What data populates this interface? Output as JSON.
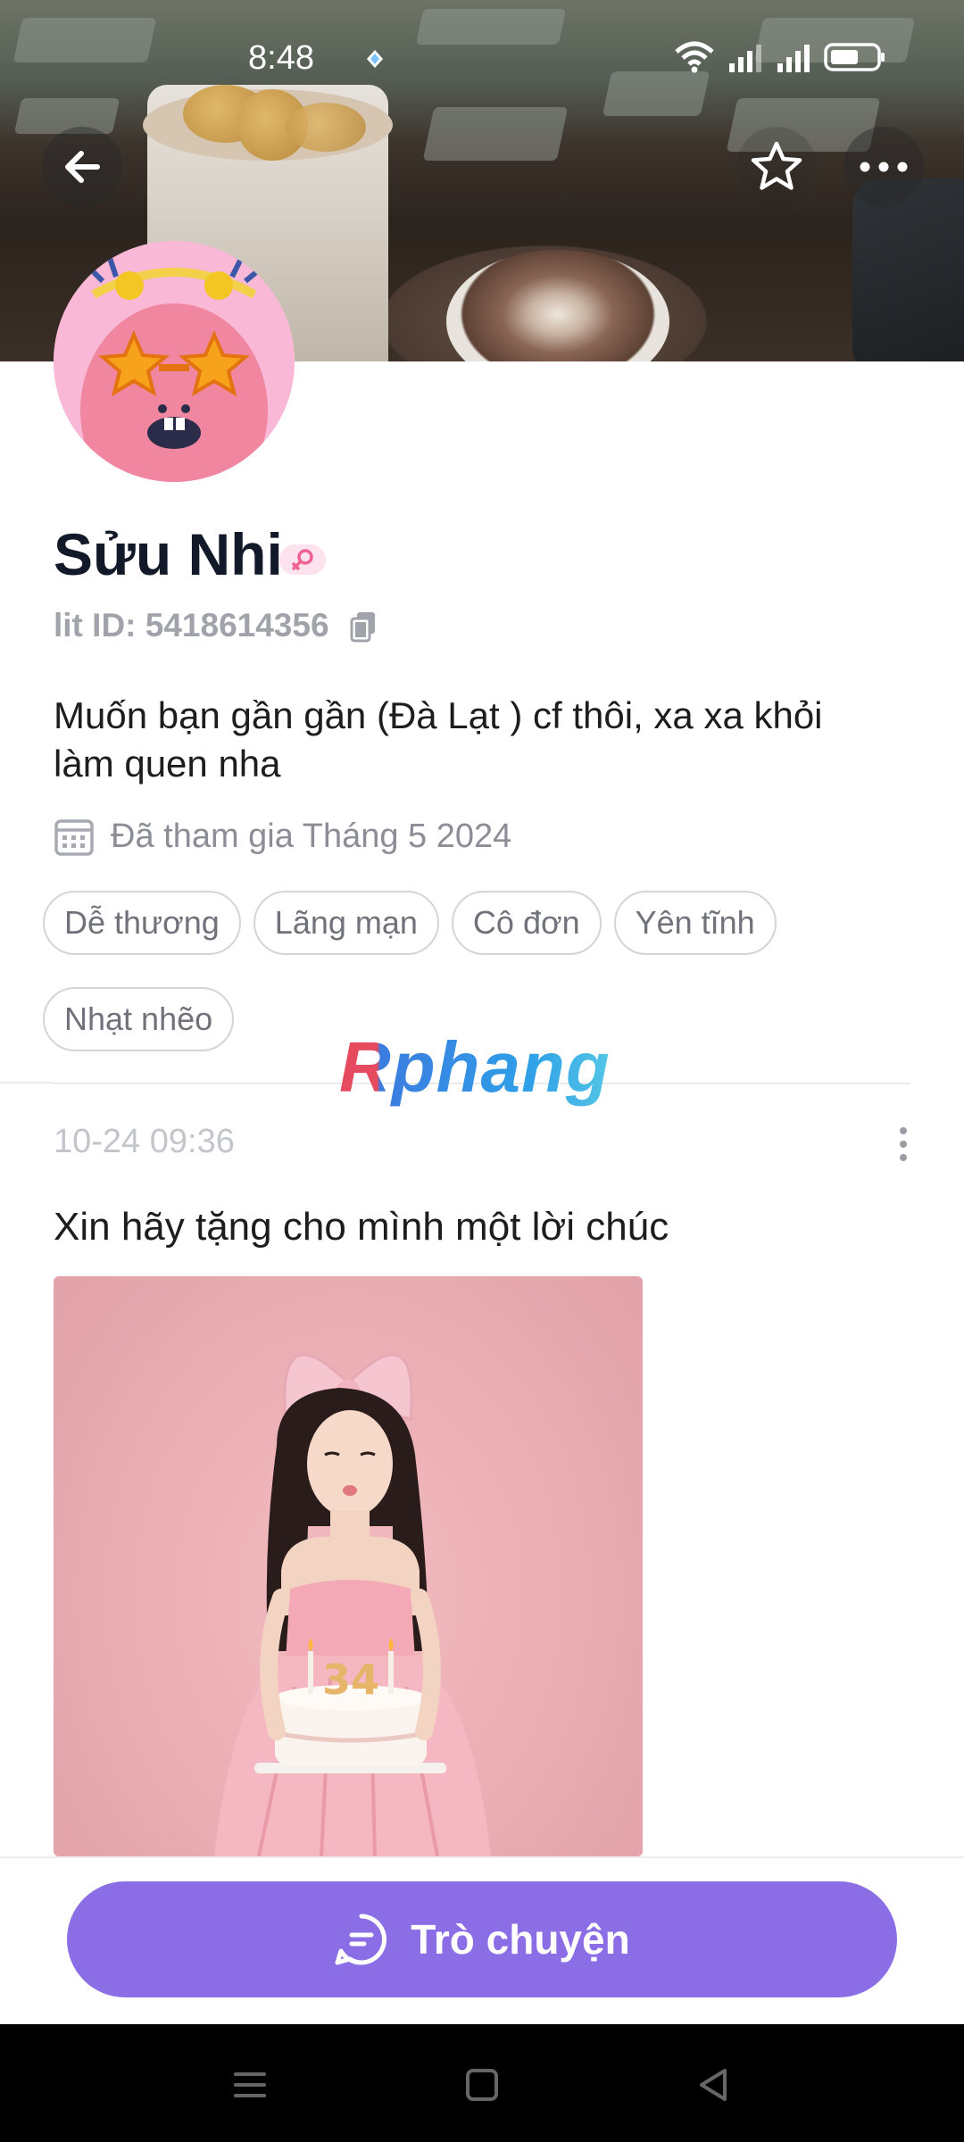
{
  "status_bar": {
    "time": "8:48",
    "icons": [
      "notification-icon",
      "wifi-icon",
      "signal-icon",
      "signal-icon",
      "battery-icon"
    ]
  },
  "header": {
    "back_icon": "back-arrow-icon",
    "favorite_icon": "star-icon",
    "more_icon": "more-horizontal-icon"
  },
  "profile": {
    "name": "Sửu Nhi",
    "gender_icon": "female-icon",
    "lit_id": "lit ID: 5418614356",
    "bio": "Muốn bạn gần gần (Đà Lạt )  cf thôi, xa xa khỏi làm quen nha",
    "joined": "Đã tham gia Tháng 5 2024",
    "tags": [
      "Dễ thương",
      "Lãng mạn",
      "Cô đơn",
      "Yên tĩnh",
      "Nhạt nhẽo"
    ]
  },
  "watermark": "Rphang",
  "post": {
    "time": "10-24 09:36",
    "caption": "Xin hãy tặng cho mình một lời chúc",
    "cake_number": "34"
  },
  "action": {
    "chat_label": "Trò chuyện"
  },
  "colors": {
    "accent": "#8b6ee6",
    "tag_border": "#d3d5d9",
    "muted_text": "#8b8f95"
  }
}
